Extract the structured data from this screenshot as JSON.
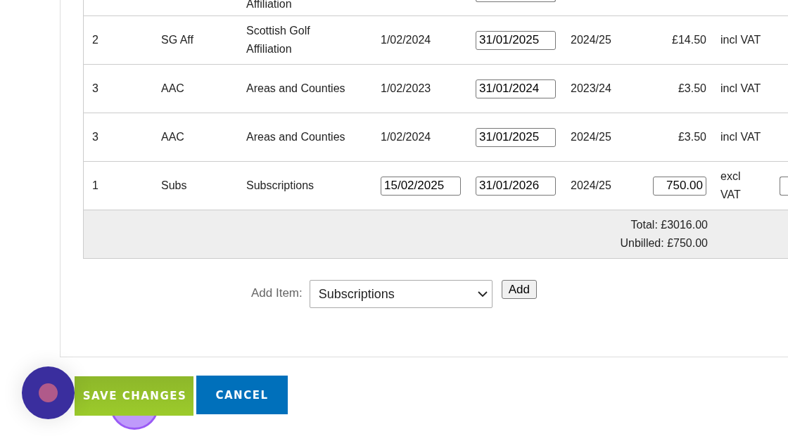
{
  "partial_row": {
    "description": "Affiliation"
  },
  "rows": [
    {
      "number": "2",
      "code": "SG Aff",
      "description": "Scottish Golf Affiliation",
      "start": {
        "value": "1/02/2024",
        "editable": false
      },
      "end": "31/01/2025",
      "period": "2024/25",
      "amount": {
        "value": "£14.50",
        "editable": false
      },
      "vat": "incl VAT",
      "extra_field": false
    },
    {
      "number": "3",
      "code": "AAC",
      "description": "Areas and Counties",
      "start": {
        "value": "1/02/2023",
        "editable": false
      },
      "end": "31/01/2024",
      "period": "2023/24",
      "amount": {
        "value": "£3.50",
        "editable": false
      },
      "vat": "incl VAT",
      "extra_field": false
    },
    {
      "number": "3",
      "code": "AAC",
      "description": "Areas and Counties",
      "start": {
        "value": "1/02/2024",
        "editable": false
      },
      "end": "31/01/2025",
      "period": "2024/25",
      "amount": {
        "value": "£3.50",
        "editable": false
      },
      "vat": "incl VAT",
      "extra_field": false
    },
    {
      "number": "1",
      "code": "Subs",
      "description": "Subscriptions",
      "start": {
        "value": "15/02/2025",
        "editable": true
      },
      "end": "31/01/2026",
      "period": "2024/25",
      "amount": {
        "value": "750.00",
        "editable": true
      },
      "vat": "excl VAT",
      "extra_field": true
    }
  ],
  "totals": {
    "total": "Total: £3016.00",
    "unbilled": "Unbilled: £750.00"
  },
  "add_item": {
    "label": "Add Item:",
    "value": "Subscriptions",
    "button": "Add"
  },
  "buttons": [
    {
      "label": "SAVE CHANGES",
      "kind": "save"
    },
    {
      "label": "CANCEL",
      "kind": "cancel"
    }
  ]
}
